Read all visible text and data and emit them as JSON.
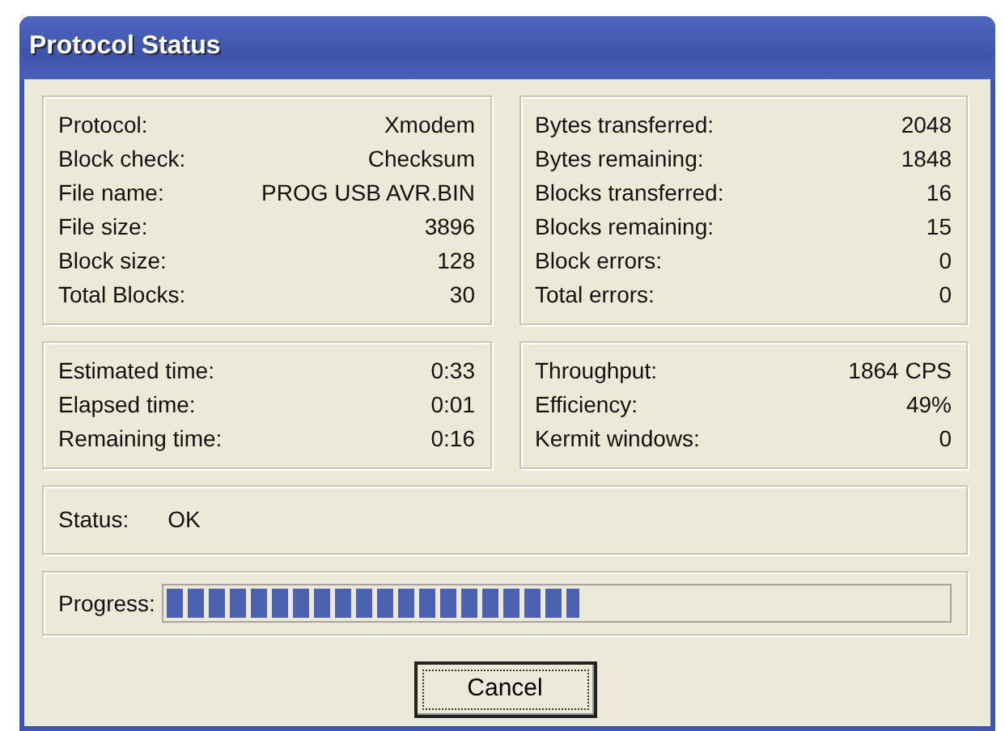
{
  "window": {
    "title": "Protocol Status"
  },
  "panels": [
    {
      "rows": [
        {
          "label": "Protocol:",
          "value": "Xmodem"
        },
        {
          "label": "Block check:",
          "value": "Checksum"
        },
        {
          "label": "File name:",
          "value": "PROG USB AVR.BIN"
        },
        {
          "label": "File size:",
          "value": "3896"
        },
        {
          "label": "Block size:",
          "value": "128"
        },
        {
          "label": "Total Blocks:",
          "value": "30"
        }
      ]
    },
    {
      "rows": [
        {
          "label": "Bytes transferred:",
          "value": "2048"
        },
        {
          "label": "Bytes remaining:",
          "value": "1848"
        },
        {
          "label": "Blocks transferred:",
          "value": "16"
        },
        {
          "label": "Blocks remaining:",
          "value": "15"
        },
        {
          "label": "Block errors:",
          "value": "0"
        },
        {
          "label": "Total errors:",
          "value": "0"
        }
      ]
    },
    {
      "rows": [
        {
          "label": "Estimated time:",
          "value": "0:33"
        },
        {
          "label": "Elapsed time:",
          "value": "0:01"
        },
        {
          "label": "Remaining time:",
          "value": "0:16"
        }
      ]
    },
    {
      "rows": [
        {
          "label": "Throughput:",
          "value": "1864 CPS"
        },
        {
          "label": "Efficiency:",
          "value": "49%"
        },
        {
          "label": "Kermit windows:",
          "value": "0"
        }
      ]
    }
  ],
  "status": {
    "label": "Status:",
    "value": "OK"
  },
  "progress": {
    "label": "Progress:",
    "level": 0.53
  },
  "buttons": [
    "Cancel"
  ]
}
